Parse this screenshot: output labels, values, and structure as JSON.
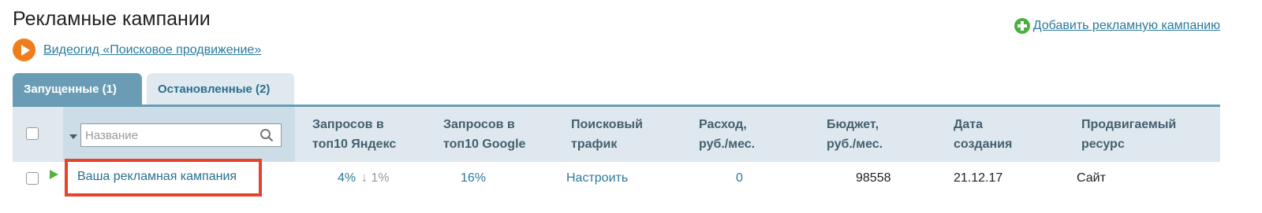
{
  "page_title": "Рекламные кампании",
  "video_guide": {
    "label": "Видеогид «Поисковое продвижение»",
    "icon": "play-icon"
  },
  "add_campaign": {
    "label": "Добавить рекламную кампанию",
    "icon": "plus-icon"
  },
  "tabs": [
    {
      "label": "Запущенные (1)",
      "active": true
    },
    {
      "label": "Остановленные (2)",
      "active": false
    }
  ],
  "table": {
    "search_placeholder": "Название",
    "columns": [
      {
        "line1": "Запросов в",
        "line2": "топ10 Яндекс"
      },
      {
        "line1": "Запросов в",
        "line2": "топ10 Google"
      },
      {
        "line1": "Поисковый",
        "line2": "трафик"
      },
      {
        "line1": "Расход,",
        "line2": "руб./мес."
      },
      {
        "line1": "Бюджет,",
        "line2": "руб./мес."
      },
      {
        "line1": "Дата",
        "line2": "создания"
      },
      {
        "line1": "Продвигаемый",
        "line2": "ресурс"
      }
    ],
    "rows": [
      {
        "name": "Ваша рекламная кампания",
        "yandex_top10": "4%",
        "yandex_change": "↓ 1%",
        "google_top10": "16%",
        "traffic": "Настроить",
        "spend": "0",
        "budget": "98558",
        "created": "21.12.17",
        "resource": "Сайт"
      }
    ]
  },
  "colors": {
    "tab_active": "#6a9db5",
    "tab_inactive": "#dfe9ef",
    "header_bg": "#dfe8ef",
    "link": "#2a7a9c",
    "highlight": "#e8432a",
    "status_running": "#55b040"
  }
}
